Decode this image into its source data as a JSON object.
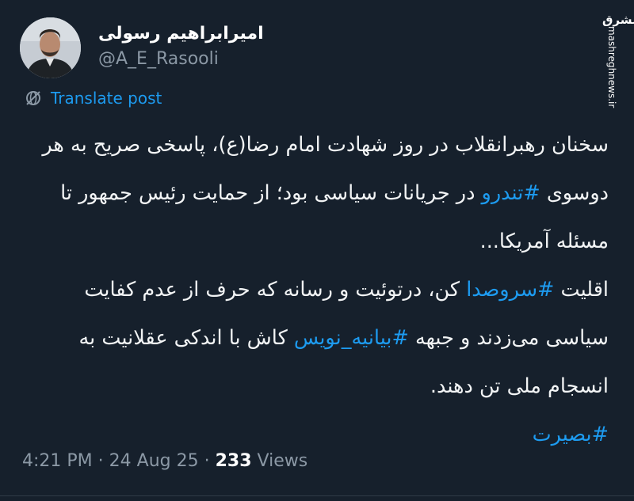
{
  "author": {
    "display_name": "امیرابراهیم رسولی",
    "username": "@A_E_Rasooli"
  },
  "watermark": {
    "logo": "مشرق",
    "site": "mashreghnews.ir"
  },
  "translate": {
    "label": "Translate post",
    "icon": "globe-strike-icon"
  },
  "tweet": {
    "paragraph1": "سخنان رهبرانقلاب در روز شهادت امام رضا(ع)، پاسخی صریح به هر دوسوی #تندرو در جریانات سیاسی بود؛ از حمایت رئیس جمهور تا مسئله آمریکا...",
    "p1_part1": "سخنان رهبرانقلاب در روز شهادت امام رضا(ع)، پاسخی صریح به هر دوسوی ",
    "p1_hashtag": "#تندرو",
    "p1_part2": " در جریانات سیاسی بود؛ از حمایت رئیس جمهور تا مسئله آمریکا...",
    "p2_part1": "اقلیت ",
    "p2_hashtag1": "#سروصدا",
    "p2_part2": " کن، درتوئیت و رسانه  که حرف از عدم کفایت سیاسی می‌زدند و جبهه ",
    "p2_hashtag2": "#بیانیه_نویس",
    "p2_part3": " کاش با اندکی عقلانیت به انسجام ملی تن دهند.",
    "p3_hashtag": "#بصیرت"
  },
  "meta": {
    "time": "4:21 PM",
    "separator": "·",
    "date": "24 Aug 25",
    "views_count": "233",
    "views_label": "Views"
  },
  "colors": {
    "background": "#16202c",
    "link": "#1d9bf0",
    "muted": "#8b98a5"
  }
}
